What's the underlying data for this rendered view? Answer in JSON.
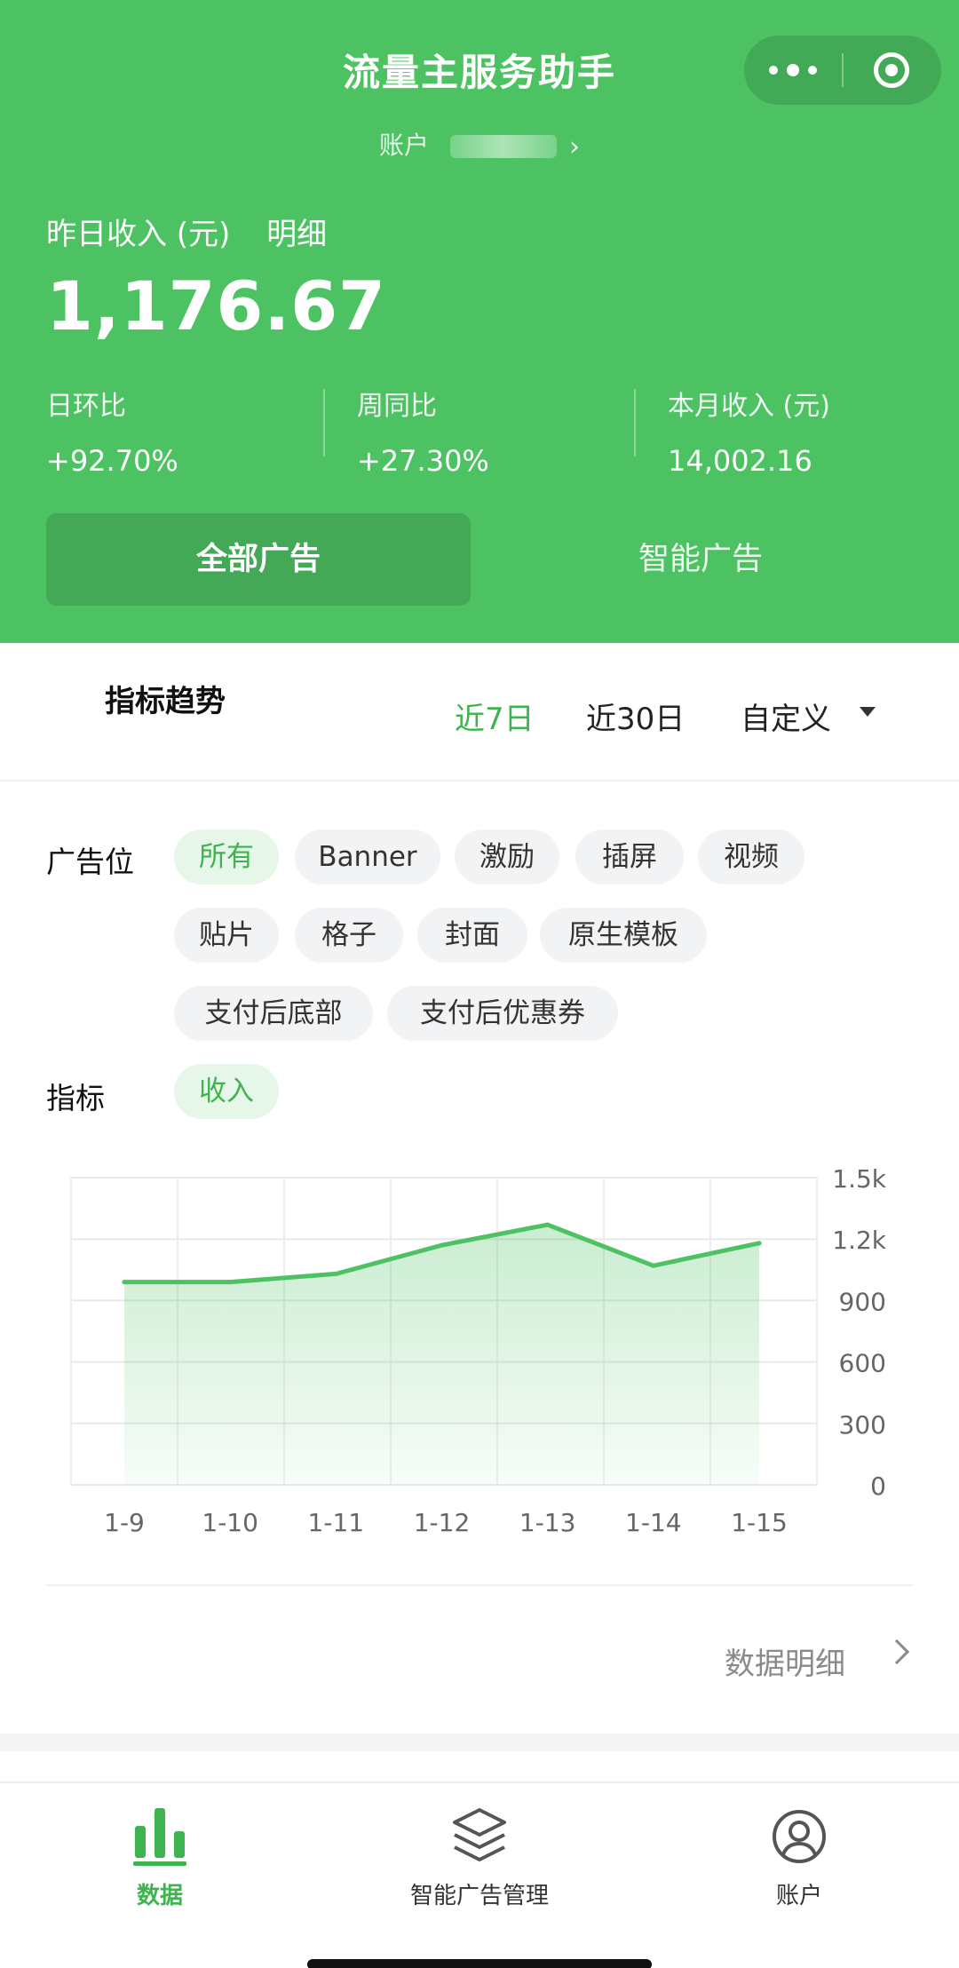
{
  "app": {
    "title": "流量主服务助手"
  },
  "account": {
    "label": "账户"
  },
  "header": {
    "yesterday_label": "昨日收入 (元)",
    "detail_link": "明细",
    "yesterday_value": "1,176.67",
    "stats": [
      {
        "label": "日环比",
        "value": "+92.70%"
      },
      {
        "label": "周同比",
        "value": "+27.30%"
      },
      {
        "label": "本月收入 (元)",
        "value": "14,002.16"
      }
    ],
    "segments": {
      "all": "全部广告",
      "smart": "智能广告"
    }
  },
  "trend": {
    "title": "指标趋势",
    "ranges": [
      "近7日",
      "近30日",
      "自定义"
    ],
    "selected_range": "近7日"
  },
  "filters": {
    "ad_slot_label": "广告位",
    "ad_slots": [
      "所有",
      "Banner",
      "激励",
      "插屏",
      "视频",
      "贴片",
      "格子",
      "封面",
      "原生模板",
      "支付后底部",
      "支付后优惠券"
    ],
    "selected_slot": "所有",
    "metric_label": "指标",
    "metrics": [
      "收入"
    ],
    "selected_metric": "收入"
  },
  "chart_data": {
    "type": "area",
    "categories": [
      "1-9",
      "1-10",
      "1-11",
      "1-12",
      "1-13",
      "1-14",
      "1-15"
    ],
    "series": [
      {
        "values": [
          990,
          990,
          1030,
          1170,
          1270,
          1070,
          1180
        ]
      }
    ],
    "y_ticks": [
      "1.5k",
      "1.2k",
      "900",
      "600",
      "300",
      "0"
    ],
    "ylim": [
      0,
      1500
    ],
    "grid": true,
    "color": "#4cc262"
  },
  "data_detail_link": "数据明细",
  "tabbar": {
    "items": [
      {
        "label": "数据",
        "icon": "bar-chart-icon",
        "active": true
      },
      {
        "label": "智能广告管理",
        "icon": "layers-icon",
        "active": false
      },
      {
        "label": "账户",
        "icon": "user-icon",
        "active": false
      }
    ]
  },
  "colors": {
    "primary": "#4cc262",
    "accent_text": "#3fb34f",
    "chip_bg": "#f2f3f5"
  }
}
